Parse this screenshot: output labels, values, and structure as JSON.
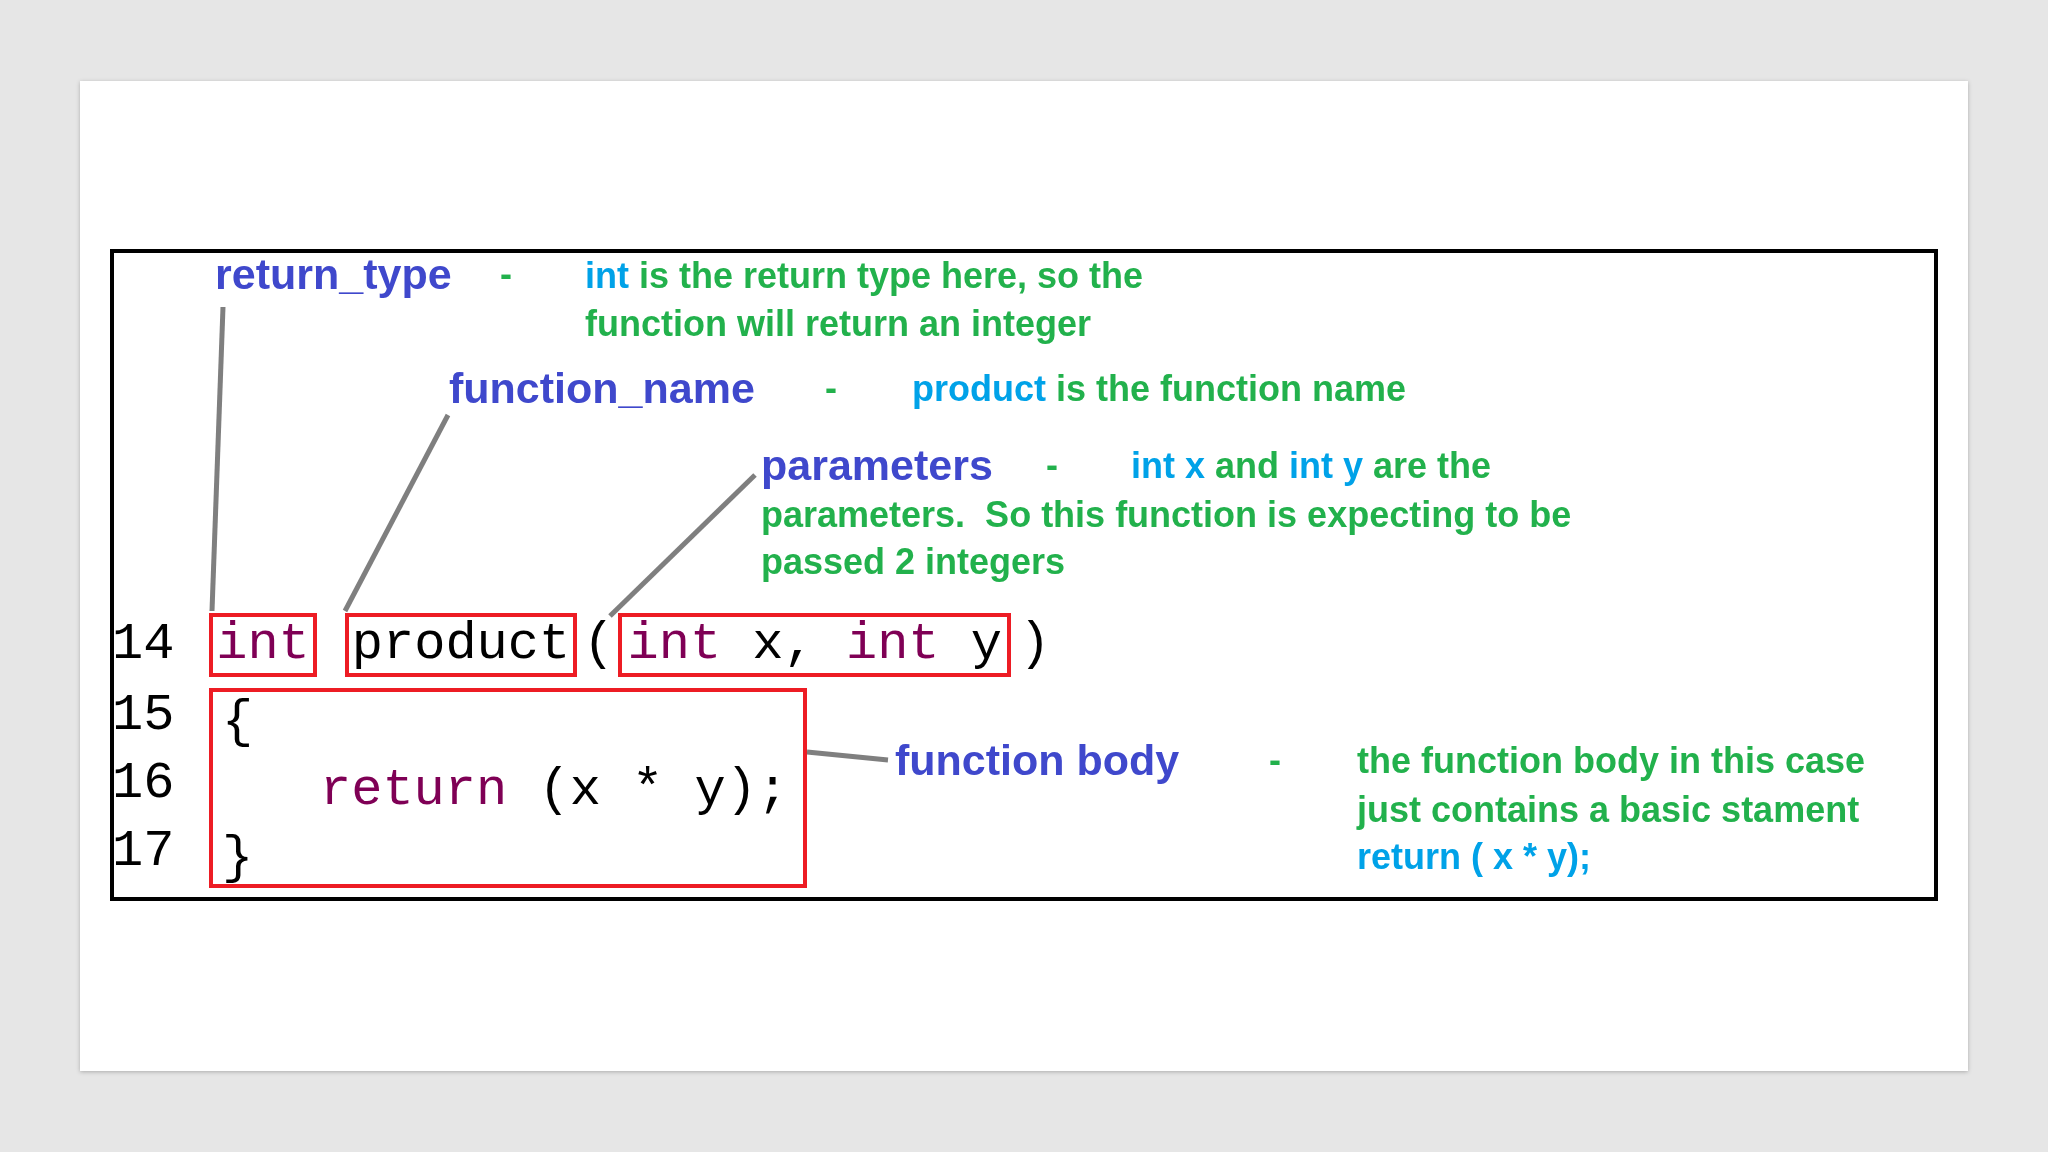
{
  "annotations": [
    {
      "label": "return_type",
      "dash": "-",
      "lines": [
        [
          {
            "text": "int",
            "kind": "code"
          },
          {
            "text": " is the return type here, so the",
            "kind": "prose"
          }
        ],
        [
          {
            "text": "function will return an integer",
            "kind": "prose"
          }
        ]
      ]
    },
    {
      "label": "function_name",
      "dash": "-",
      "lines": [
        [
          {
            "text": "product",
            "kind": "code"
          },
          {
            "text": " is the function name",
            "kind": "prose"
          }
        ]
      ]
    },
    {
      "label": "parameters",
      "dash": "-",
      "lines": [
        [
          {
            "text": "int x",
            "kind": "code"
          },
          {
            "text": " and ",
            "kind": "prose"
          },
          {
            "text": "int y",
            "kind": "code"
          },
          {
            "text": " are the",
            "kind": "prose"
          }
        ],
        [
          {
            "text": "parameters.  So this function is expecting to be",
            "kind": "prose"
          }
        ],
        [
          {
            "text": "passed 2 integers",
            "kind": "prose"
          }
        ]
      ]
    },
    {
      "label": "function body",
      "dash": "-",
      "lines": [
        [
          {
            "text": "the function body in this case",
            "kind": "prose"
          }
        ],
        [
          {
            "text": "just contains a basic stament",
            "kind": "prose"
          }
        ],
        [
          {
            "text": "return ( x * y);",
            "kind": "code"
          }
        ]
      ]
    }
  ],
  "code_header": {
    "number": "14",
    "segments": [
      {
        "highlighted": true,
        "tokens": [
          {
            "text": "int",
            "kind": "keyword"
          }
        ]
      },
      {
        "highlighted": true,
        "tokens": [
          {
            "text": "product",
            "kind": "plain"
          }
        ]
      },
      {
        "highlighted": false,
        "tokens": [
          {
            "text": "(",
            "kind": "plain"
          }
        ]
      },
      {
        "highlighted": true,
        "tokens": [
          {
            "text": "int",
            "kind": "keyword"
          },
          {
            "text": " x, ",
            "kind": "plain"
          },
          {
            "text": "int",
            "kind": "keyword"
          },
          {
            "text": " y",
            "kind": "plain"
          }
        ]
      },
      {
        "highlighted": false,
        "tokens": [
          {
            "text": ")",
            "kind": "plain"
          }
        ]
      }
    ]
  },
  "code_body": {
    "highlighted": true,
    "lines": [
      {
        "number": "15",
        "tokens": [
          {
            "text": "{",
            "kind": "plain"
          }
        ]
      },
      {
        "number": "16",
        "tokens": [
          {
            "text": "return",
            "kind": "keyword"
          },
          {
            "text": " (x * y);",
            "kind": "plain"
          }
        ]
      },
      {
        "number": "17",
        "tokens": [
          {
            "text": "}",
            "kind": "plain"
          }
        ]
      }
    ]
  }
}
